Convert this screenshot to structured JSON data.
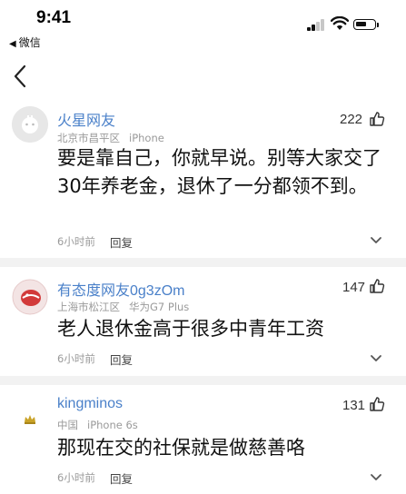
{
  "status_bar": {
    "time": "9:41",
    "back_app_label": "微信"
  },
  "comments": [
    {
      "username": "火星网友",
      "location": "北京市昌平区",
      "device": "iPhone",
      "likes": "222",
      "text": "要是靠自己，你就早说。别等大家交了30年养老金，退休了一分都领不到。",
      "time_ago": "6小时前",
      "reply_label": "回复"
    },
    {
      "username": "有态度网友0g3zOm",
      "location": "上海市松江区",
      "device": "华为G7 Plus",
      "likes": "147",
      "text": "老人退休金高于很多中青年工资",
      "time_ago": "6小时前",
      "reply_label": "回复"
    },
    {
      "username": "kingminos",
      "location": "中国",
      "device": "iPhone 6s",
      "likes": "131",
      "text": "那现在交的社保就是做慈善咯",
      "time_ago": "6小时前",
      "reply_label": "回复"
    }
  ]
}
